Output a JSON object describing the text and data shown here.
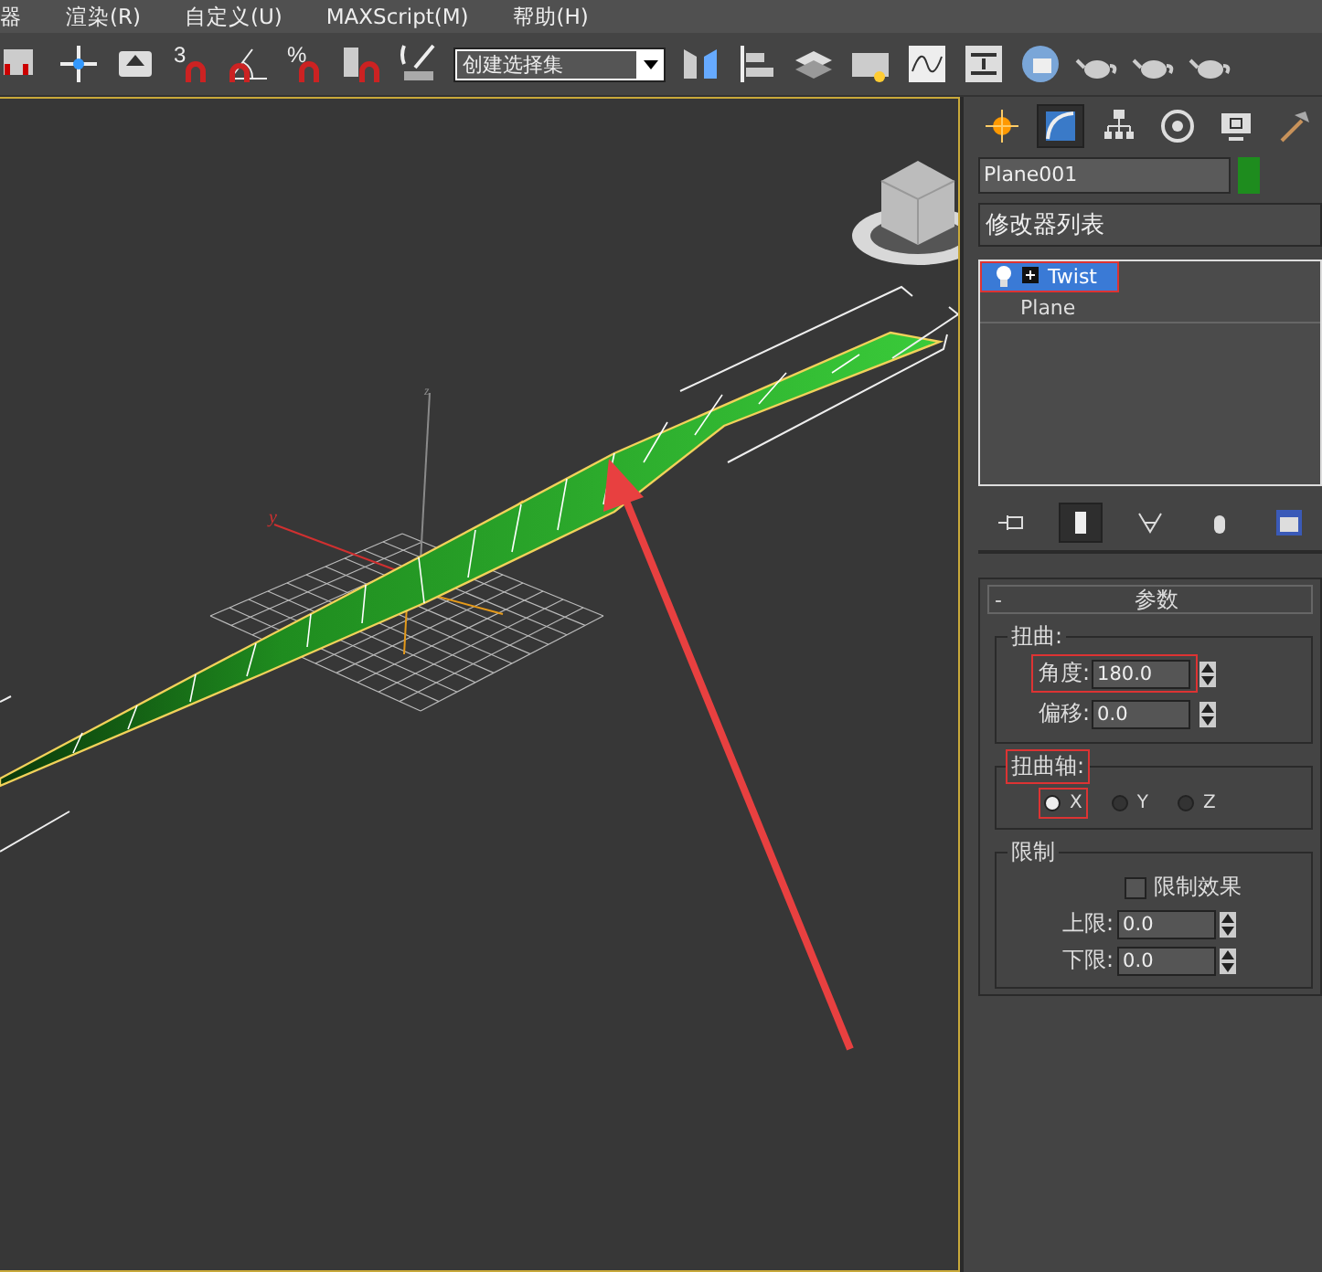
{
  "menu": [
    "器",
    "渲染(R)",
    "自定义(U)",
    "MAXScript(M)",
    "帮助(H)"
  ],
  "toolbar": [
    {
      "kind": "select"
    },
    {
      "kind": "move"
    },
    {
      "kind": "place"
    },
    {
      "kind": "snap",
      "label": "3"
    },
    {
      "kind": "angle-snap"
    },
    {
      "kind": "percent-snap",
      "label": "%"
    },
    {
      "kind": "spinner-snap"
    },
    {
      "kind": "named-sets"
    },
    {
      "kind": "selection-set",
      "value": "创建选择集"
    },
    {
      "kind": "mirror"
    },
    {
      "kind": "align"
    },
    {
      "kind": "layers"
    },
    {
      "kind": "explorer"
    },
    {
      "kind": "curve"
    },
    {
      "kind": "schematic"
    },
    {
      "kind": "material"
    },
    {
      "kind": "teapot"
    },
    {
      "kind": "teapot"
    },
    {
      "kind": "teapot"
    }
  ],
  "viewport": {
    "axis_labels": [
      {
        "kind": "y",
        "text": "y"
      },
      {
        "kind": "z",
        "text": "z"
      }
    ]
  },
  "command_tabs": [
    {
      "kind": "create",
      "selected": false
    },
    {
      "kind": "modify",
      "selected": true
    },
    {
      "kind": "hierarchy",
      "selected": false
    },
    {
      "kind": "motion",
      "selected": false
    },
    {
      "kind": "display",
      "selected": false
    },
    {
      "kind": "utilities",
      "selected": false
    }
  ],
  "object": {
    "name": "Plane001",
    "color": "#1e8c1e"
  },
  "modifier_list": {
    "value": "修改器列表"
  },
  "stack": [
    {
      "label": "Twist",
      "kind": "modifier",
      "selected": true,
      "highlighted": true
    },
    {
      "label": "Plane",
      "kind": "base",
      "selected": false,
      "highlighted": false
    }
  ],
  "stack_tools": [
    {
      "kind": "pin",
      "selected": false
    },
    {
      "kind": "end-result",
      "selected": true
    },
    {
      "kind": "unique",
      "selected": false
    },
    {
      "kind": "remove",
      "selected": false
    },
    {
      "kind": "configure",
      "selected": false
    }
  ],
  "rollout": {
    "toggle": "-",
    "title": "参数",
    "twist_group": {
      "title": "扭曲:",
      "fields": [
        {
          "label": "角度:",
          "value": "180.0",
          "highlighted": true
        },
        {
          "label": "偏移:",
          "value": "0.0",
          "highlighted": false
        }
      ]
    },
    "axis_group": {
      "title": "扭曲轴:",
      "highlighted": true,
      "options": [
        {
          "label": "X",
          "selected": true
        },
        {
          "label": "Y",
          "selected": false
        },
        {
          "label": "Z",
          "selected": false
        }
      ]
    },
    "limit_group": {
      "title": "限制",
      "checkbox": {
        "label": "限制效果",
        "checked": false
      },
      "fields": [
        {
          "label": "上限:",
          "value": "0.0"
        },
        {
          "label": "下限:",
          "value": "0.0"
        }
      ]
    }
  }
}
